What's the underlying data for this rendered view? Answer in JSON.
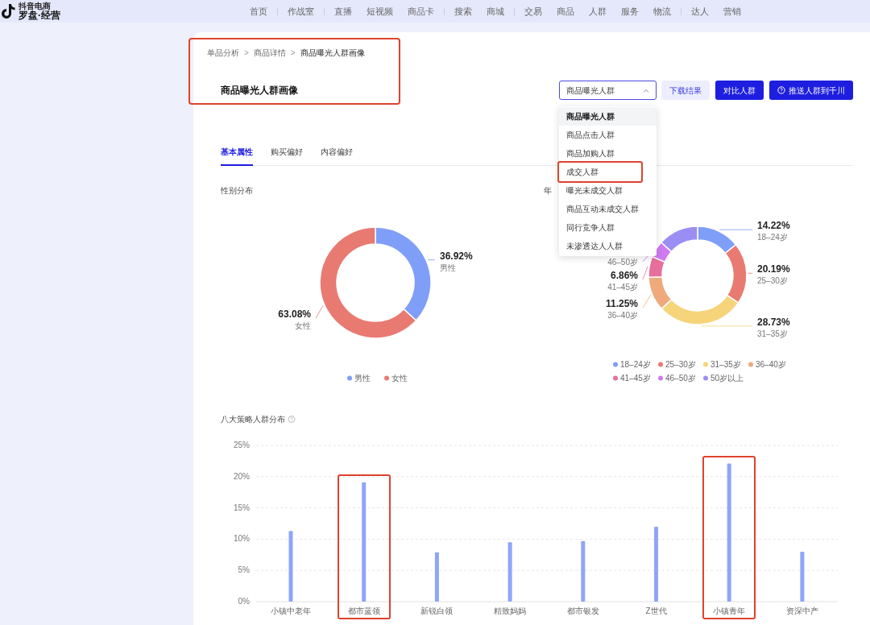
{
  "logo": {
    "top": "抖音电商",
    "name": "罗盘·经营"
  },
  "nav_groups": [
    {
      "items": [
        "首页"
      ]
    },
    {
      "items": [
        "作战室"
      ]
    },
    {
      "items": [
        "直播",
        "短视频",
        "商品卡"
      ]
    },
    {
      "items": [
        "搜索",
        "商城"
      ]
    },
    {
      "items": [
        "交易",
        "商品",
        "人群",
        "服务",
        "物流"
      ]
    },
    {
      "items": [
        "达人",
        "营销"
      ]
    }
  ],
  "breadcrumb": [
    "单品分析",
    "商品详情",
    "商品曝光人群画像"
  ],
  "breadcrumb_separator": ">",
  "page_title": "商品曝光人群画像",
  "header_highlighted": true,
  "population_select": {
    "value": "商品曝光人群",
    "expanded": true,
    "options": [
      {
        "label": "商品曝光人群",
        "selected": true,
        "highlighted": false
      },
      {
        "label": "商品点击人群",
        "selected": false,
        "highlighted": false
      },
      {
        "label": "商品加购人群",
        "selected": false,
        "highlighted": false
      },
      {
        "label": "成交人群",
        "selected": false,
        "highlighted": true
      },
      {
        "label": "曝光未成交人群",
        "selected": false,
        "highlighted": false
      },
      {
        "label": "商品互动未成交人群",
        "selected": false,
        "highlighted": false
      },
      {
        "label": "同行竞争人群",
        "selected": false,
        "highlighted": false
      },
      {
        "label": "未渗透达人人群",
        "selected": false,
        "highlighted": false
      }
    ]
  },
  "buttons": [
    {
      "label": "下载结果",
      "kind": "secondary"
    },
    {
      "label": "对比人群",
      "kind": "primary"
    },
    {
      "label": "推送人群到千川",
      "kind": "primary_icon"
    }
  ],
  "tabs": [
    {
      "label": "基本属性",
      "selected": true
    },
    {
      "label": "购买偏好",
      "selected": false
    },
    {
      "label": "内容偏好",
      "selected": false
    }
  ],
  "gender_panel": {
    "title": "性别分布",
    "chart_data": {
      "type": "donut",
      "categories": [
        "男性",
        "女性"
      ],
      "series": [
        {
          "colors": [
            "#7f9ef8",
            "#e97a72"
          ],
          "values": [
            36.92,
            63.08
          ]
        }
      ],
      "value_labels": [
        "36.92%",
        "63.08%"
      ],
      "legend": "bottom"
    }
  },
  "age_panel": {
    "title": "年",
    "chart_data": {
      "type": "donut",
      "categories": [
        "18–24岁",
        "25–30岁",
        "31–35岁",
        "36–40岁",
        "41–45岁",
        "46–50岁",
        "50岁以上"
      ],
      "series": [
        {
          "colors": [
            "#7f9ef8",
            "#e97a72",
            "#f5d47a",
            "#f0a97a",
            "#e86f9b",
            "#cf7af0",
            "#9a8ef5"
          ],
          "values": [
            14.22,
            20.19,
            28.73,
            11.25,
            6.86,
            5.5,
            13.25
          ]
        }
      ],
      "value_labels": [
        "14.22%",
        "20.19%",
        "28.73%",
        "11.25%",
        "6.86%",
        null,
        null
      ],
      "annotations": [
        {
          "text": "46–50岁",
          "x": "46–50岁"
        }
      ],
      "legend": "bottom"
    }
  },
  "strategy_panel": {
    "title": "八大策略人群分布",
    "highlighted": [
      false,
      true,
      false,
      false,
      false,
      false,
      true,
      false
    ],
    "chart_data": {
      "type": "bar",
      "categories": [
        "小镇中老年",
        "都市蓝领",
        "新锐白领",
        "精致妈妈",
        "都市银发",
        "Z世代",
        "小镇青年",
        "资深中产"
      ],
      "series": [
        {
          "color": "#8ea6f7",
          "values": [
            11.3,
            19.1,
            7.9,
            9.5,
            9.7,
            12.0,
            22.1,
            8.0
          ]
        }
      ],
      "ylim": [
        0,
        25
      ],
      "grid": true,
      "yticks": [
        {
          "value": 0,
          "label": "0%"
        },
        {
          "value": 5,
          "label": "5%"
        },
        {
          "value": 10,
          "label": "10%"
        },
        {
          "value": 15,
          "label": "15%"
        },
        {
          "value": 20,
          "label": "20%"
        },
        {
          "value": 25,
          "label": "25%"
        }
      ]
    }
  }
}
